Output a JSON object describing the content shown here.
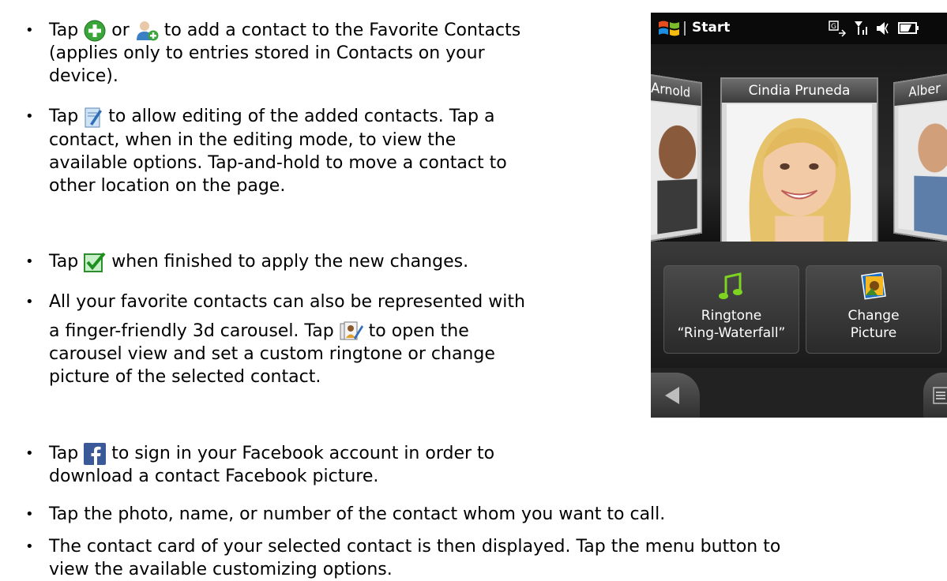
{
  "bullets": [
    {
      "part1": "Tap",
      "part2": "or",
      "part3": "to add a contact to the Favorite Contacts",
      "line2": "(applies only to entries stored in Contacts on your",
      "line3": "device).",
      "icons": [
        "green-plus-icon",
        "add-person-icon"
      ]
    },
    {
      "part1": "Tap",
      "part2": "to allow editing of the added contacts. Tap a",
      "line2": "contact, when in the editing mode, to view the",
      "line3": "available options. Tap-and-hold to move a contact to",
      "line4": "other location on the page.",
      "icons": [
        "edit-icon"
      ]
    },
    {
      "part1": "Tap",
      "part2": "when finished to apply the new changes.",
      "icons": [
        "green-check-icon"
      ]
    },
    {
      "line1": "All your favorite contacts can also be represented with",
      "part1": "a finger-friendly 3d carousel. Tap",
      "part2": "to open the",
      "line3": "carousel view and set a custom ringtone or change",
      "line4": "picture of the selected contact.",
      "icons": [
        "carousel-icon"
      ]
    },
    {
      "part1": "Tap",
      "part2": "to sign in your Facebook account in order to",
      "line2": "download a contact Facebook picture.",
      "icons": [
        "facebook-icon"
      ]
    },
    {
      "line1": "Tap the photo, name, or number of the contact whom you want to call."
    },
    {
      "line1": "The contact card of your selected contact is then displayed. Tap the menu button to",
      "line2": "view the available customizing options."
    }
  ],
  "phone": {
    "status": {
      "start_label": "Start"
    },
    "carousel": {
      "left_name": "Arnold",
      "center_name": "Cindia Pruneda",
      "right_name": "Alber"
    },
    "actions": {
      "ringtone_line1": "Ringtone",
      "ringtone_line2": "“Ring-Waterfall”",
      "picture_line1": "Change",
      "picture_line2": "Picture"
    }
  }
}
